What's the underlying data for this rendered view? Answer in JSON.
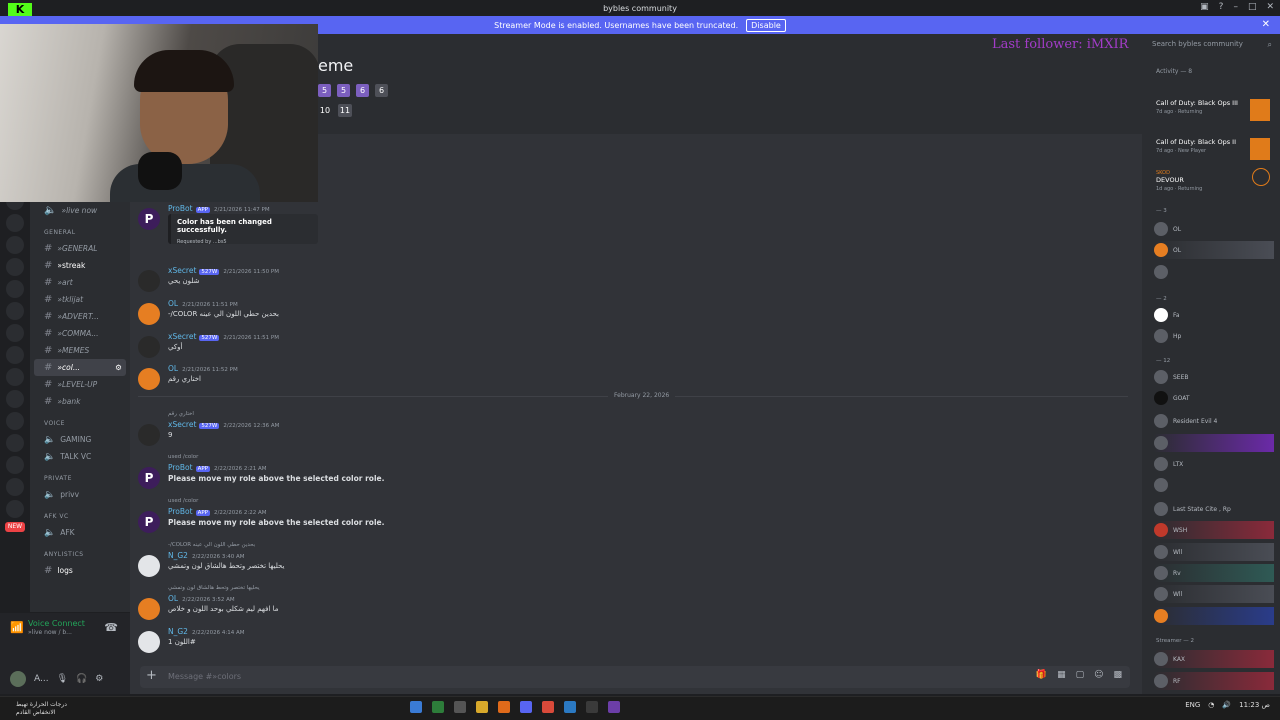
{
  "window": {
    "title": "bybles community"
  },
  "banner": {
    "text": "Streamer Mode is enabled. Usernames have been truncated.",
    "button": "Disable",
    "close": "✕"
  },
  "overlay": {
    "last_follower": "Last follower: iMXIR"
  },
  "servers": {
    "new_badge": "NEW"
  },
  "channels": {
    "top_item": "»live now",
    "categories": {
      "general": "GENERAL",
      "voice": "VOICE",
      "private": "PRIVATE",
      "afk": "AFK VC",
      "logs": "ANYLISTICS"
    },
    "general_items": [
      "»GENERAL",
      "»streak",
      "»art",
      "»tklijat",
      "»ADVERT...",
      "»COMMA...",
      "»MEMES",
      "»col...",
      "»LEVEL-UP",
      "»bank"
    ],
    "voice_items": [
      "GAMING",
      "TALK VC"
    ],
    "private_items": [
      "privv"
    ],
    "afk_items": [
      "AFK"
    ],
    "log_items": [
      "logs"
    ]
  },
  "voice_panel": {
    "title": "Voice Connect",
    "sub": "»live now / b..."
  },
  "user_bar": {
    "name": "A..."
  },
  "header": {
    "title_fragment": "eme",
    "pages_row1": [
      "5",
      "5",
      "6",
      "6"
    ],
    "pages_row2": [
      "10",
      "11"
    ]
  },
  "messages": [
    {
      "name": "ProBot",
      "tag": "APP",
      "time": "2/21/2026 11:47 PM",
      "embed_title": "Color has been changed successfully.",
      "embed_footer": "Requested by ...bs5"
    },
    {
      "name": "xSecret",
      "tag": "527W",
      "time": "2/21/2026 11:50 PM",
      "body": "شلون يحي"
    },
    {
      "name": "OL",
      "tag": "OL",
      "time": "2/21/2026 11:51 PM",
      "body": "-/COLOR بحدين حطي اللون الي عينه"
    },
    {
      "name": "xSecret",
      "tag": "527W",
      "time": "2/21/2026 11:51 PM",
      "body": "أوكي"
    },
    {
      "name": "OL",
      "tag": "OL",
      "time": "2/21/2026 11:52 PM",
      "body": "اختاري رقم"
    },
    {
      "reply": "اختاري رقم",
      "name": "xSecret",
      "tag": "527W",
      "time": "2/22/2026 12:36 AM",
      "body": "9"
    },
    {
      "reply": "used /color",
      "name": "ProBot",
      "tag": "APP",
      "time": "2/22/2026 2:21 AM",
      "body": "Please move my role above the selected color role."
    },
    {
      "reply": "used /color",
      "name": "ProBot",
      "tag": "APP",
      "time": "2/22/2026 2:22 AM",
      "body": "Please move my role above the selected color role."
    },
    {
      "reply": "-/COLOR بحدين حطي اللون الي عينه",
      "name": "N_G2",
      "tag": "",
      "time": "2/22/2026 3:40 AM",
      "body": "يحليها تختصر وتحط هالشاق لون وتمشي"
    },
    {
      "reply": "يحليها تختصر وتحط هالشاق لون وتمشي",
      "name": "OL",
      "tag": "OL",
      "time": "2/22/2026 3:52 AM",
      "body": "ما افهم ليم شكلي بوحد اللون و خلاص"
    },
    {
      "name": "N_G2",
      "tag": "",
      "time": "2/22/2026 4:14 AM",
      "body": "اللون 1#"
    }
  ],
  "date_divider": "February 22, 2026",
  "composer": {
    "placeholder": "Message #»colors"
  },
  "right": {
    "search_placeholder": "Search bybles community",
    "activity_header": "Activity — 8",
    "activities": [
      {
        "game": "Call of Duty: Black Ops III",
        "meta": "7d ago · Returning"
      },
      {
        "game": "Call of Duty: Black Ops II",
        "meta": "7d ago · New Player"
      },
      {
        "name": "SKOD",
        "game": "DEVOUR",
        "meta": "1d ago · Returning"
      }
    ],
    "groups": [
      "— 3",
      "— 2",
      "— 12",
      "Streamer — 2"
    ],
    "members": [
      "OL",
      "OL",
      "",
      "Fa",
      "Hp",
      "SEEB",
      "GOAT",
      "Resident Evil 4",
      "",
      "LTX",
      "",
      "Last State Cite , Rp",
      "WSH",
      "Wll",
      "Rv",
      "Wll",
      "",
      "KAX",
      "RF"
    ]
  },
  "taskbar": {
    "weather_line1": "درجات الحرارة تهبط",
    "weather_line2": "الانخفاض القادم",
    "tray_lang": "ENG",
    "tray_time": "11:23 ص"
  }
}
